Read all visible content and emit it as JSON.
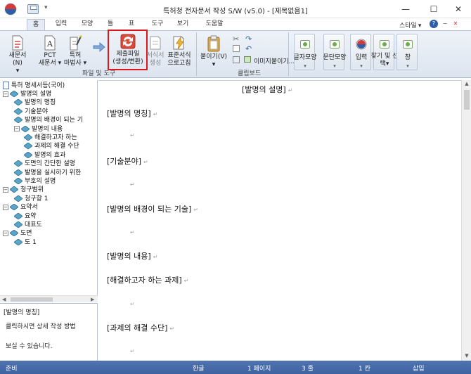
{
  "window": {
    "title": "특허청 전자문서 작성 S/W (v5.0) - [제목없음1]",
    "qa_dropdown": "▾",
    "minimize": "—",
    "maximize": "☐",
    "close": "✕"
  },
  "tabs": [
    {
      "label": "홈",
      "active": true
    },
    {
      "label": "입력"
    },
    {
      "label": "모양"
    },
    {
      "label": "틀"
    },
    {
      "label": "표"
    },
    {
      "label": "도구"
    },
    {
      "label": "보기"
    },
    {
      "label": "도움말"
    }
  ],
  "style_label": "스타일",
  "style_arrow": "▾",
  "ribbon": {
    "new_doc": {
      "line1": "새문서(N)",
      "line2": "▾"
    },
    "pct": {
      "line1": "PCT",
      "line2": "새문서 ▾"
    },
    "patent_wizard": {
      "line1": "특허",
      "line2": "마법사 ▾"
    },
    "submit_file": {
      "line1": "제출파일",
      "line2": "(생성/변환)"
    },
    "form_create": {
      "line1": "서식서",
      "line2": "생성"
    },
    "standard_form": {
      "line1": "표준서식",
      "line2": "으로고침"
    },
    "paste": {
      "line1": "붙이기(V)",
      "line2": "▾"
    },
    "paste_image": "이미지붙이기...",
    "group_file_tools": "파일 및 도구",
    "group_clipboard": "클립보드",
    "mini_buttons": [
      {
        "label": "글자모양",
        "arrow": "▾"
      },
      {
        "label": "문단모양",
        "arrow": "▾"
      },
      {
        "label": "입력",
        "arrow": "▾"
      },
      {
        "label": "찾기 및 선택▾",
        "arrow": ""
      },
      {
        "label": "창",
        "arrow": "▾"
      }
    ]
  },
  "tree": {
    "root": "특허 명세서등(국어)",
    "items": [
      {
        "label": "발명의 설명",
        "level": 1,
        "expander": "−"
      },
      {
        "label": "발명의 명칭",
        "level": 2
      },
      {
        "label": "기술분야",
        "level": 2
      },
      {
        "label": "발명의 배경이 되는 기",
        "level": 2
      },
      {
        "label": "발명의 내용",
        "level": 2,
        "expander": "−"
      },
      {
        "label": "해결하고자 하는",
        "level": 3
      },
      {
        "label": "과제의 해결 수단",
        "level": 3
      },
      {
        "label": "발명의 효과",
        "level": 3
      },
      {
        "label": "도면의 간단한 설명",
        "level": 2
      },
      {
        "label": "발명을 실시하기 위한",
        "level": 2
      },
      {
        "label": "부호의 설명",
        "level": 2
      },
      {
        "label": "청구범위",
        "level": 1,
        "expander": "−"
      },
      {
        "label": "청구항 1",
        "level": 2
      },
      {
        "label": "요약서",
        "level": 1,
        "expander": "−"
      },
      {
        "label": "요약",
        "level": 2
      },
      {
        "label": "대표도",
        "level": 2
      },
      {
        "label": "도면",
        "level": 1,
        "expander": "−"
      },
      {
        "label": "도 1",
        "level": 2
      }
    ]
  },
  "help": {
    "title": "[발명의 명칭]",
    "line1": "클릭하시면 상세 작성 방법",
    "line2": "보실 수 있습니다."
  },
  "editor": {
    "paragraph_mark": "↵",
    "heading": "[발명의 설명]",
    "sections": [
      "[발명의 명칭]",
      "[기술분야]",
      "[발명의 배경이 되는 기술]",
      "[발명의 내용]",
      "[해결하고자 하는 과제]",
      "[과제의 해결 수단]"
    ]
  },
  "status": {
    "ready": "준비",
    "language": "한글",
    "page": "1 페이지",
    "line": "3 줄",
    "column": "1 칸",
    "mode": "삽입"
  },
  "colors": {
    "ribbon_bg": "#e4ebf4",
    "status_bar": "#4a6ea8",
    "highlight_box": "#e0151b",
    "tree_node": "#5aa5c8"
  }
}
